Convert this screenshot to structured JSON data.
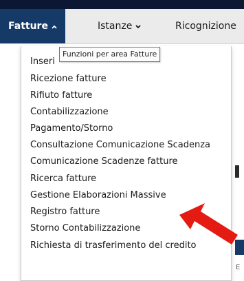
{
  "nav": {
    "items": [
      {
        "label": "Fatture",
        "chevron": "chevron-up-icon",
        "active": true
      },
      {
        "label": "Istanze",
        "chevron": "chevron-down-icon",
        "active": false
      },
      {
        "label": "Ricognizione",
        "active": false
      }
    ],
    "active_color": "#163a68"
  },
  "tooltip": {
    "text": "Funzioni per area Fatture"
  },
  "menu": {
    "items": [
      {
        "label": "Inseri"
      },
      {
        "label": "Ricezione fatture"
      },
      {
        "label": "Rifiuto fatture"
      },
      {
        "label": "Contabilizzazione"
      },
      {
        "label": "Pagamento/Storno"
      },
      {
        "label": "Consultazione Comunicazione Scadenza"
      },
      {
        "label": "Comunicazione Scadenze fatture"
      },
      {
        "label": "Ricerca fatture"
      },
      {
        "label": "Gestione Elaborazioni Massive"
      },
      {
        "label": "Registro fatture"
      },
      {
        "label": "Storno Contabilizzazione"
      },
      {
        "label": "Richiesta di trasferimento del credito"
      }
    ]
  },
  "annotation": {
    "arrow_color": "#e41b13",
    "points_to": "Gestione Elaborazioni Massive"
  }
}
